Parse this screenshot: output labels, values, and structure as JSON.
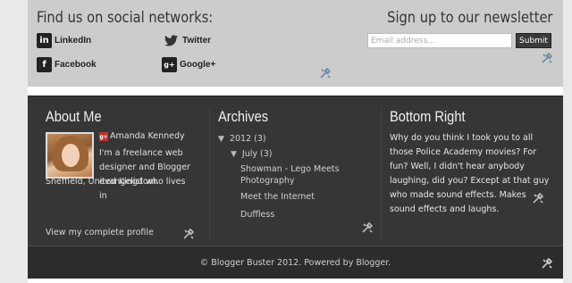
{
  "social": {
    "title": "Find us on social networks:",
    "items": [
      {
        "label": "LinkedIn",
        "icon": "linkedin-icon"
      },
      {
        "label": "Twitter",
        "icon": "twitter-icon"
      },
      {
        "label": "Facebook",
        "icon": "facebook-icon"
      },
      {
        "label": "Google+",
        "icon": "googleplus-icon"
      }
    ]
  },
  "newsletter": {
    "title": "Sign up to our newsletter",
    "email_placeholder": "Email address...",
    "submit_label": "Submit"
  },
  "about": {
    "title": "About Me",
    "author": "Amanda Kennedy",
    "bio_1": "I'm a freelance web designer and Blogger evangelist who lives in",
    "bio_2": "Sheffield, United Kingdom.",
    "profile_link": "View my complete profile"
  },
  "archives": {
    "title": "Archives",
    "year": "2012",
    "year_count": "(3)",
    "month": "July",
    "month_count": "(3)",
    "posts": [
      "Showman - Lego Meets Photography",
      "Meet the Internet",
      "Duffless"
    ]
  },
  "bottom_right": {
    "title": "Bottom Right",
    "text": "Why do you think I took you to all those Police Academy movies? For fun? Well, I didn't hear anybody laughing, did you? Except at that guy who made sound effects. Makes sound effects and laughs."
  },
  "footer": {
    "credits": "© Blogger Buster 2012. Powered by Blogger."
  },
  "colors": {
    "social_band": "#cccccc",
    "dark_panel": "#363636",
    "credits_bar": "#2c2c2c"
  }
}
